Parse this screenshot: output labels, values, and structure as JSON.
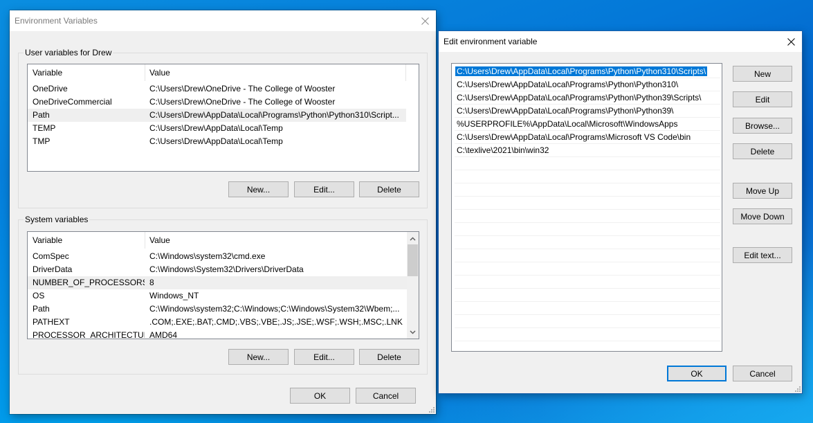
{
  "env_dialog": {
    "title": "Environment Variables",
    "user_group": {
      "label": "User variables for Drew",
      "columns": [
        "Variable",
        "Value"
      ],
      "rows": [
        {
          "variable": "OneDrive",
          "value": "C:\\Users\\Drew\\OneDrive - The College of Wooster"
        },
        {
          "variable": "OneDriveCommercial",
          "value": "C:\\Users\\Drew\\OneDrive - The College of Wooster"
        },
        {
          "variable": "Path",
          "value": "C:\\Users\\Drew\\AppData\\Local\\Programs\\Python\\Python310\\Script..."
        },
        {
          "variable": "TEMP",
          "value": "C:\\Users\\Drew\\AppData\\Local\\Temp"
        },
        {
          "variable": "TMP",
          "value": "C:\\Users\\Drew\\AppData\\Local\\Temp"
        }
      ],
      "highlighted_row": 2,
      "buttons": {
        "new": "New...",
        "edit": "Edit...",
        "delete": "Delete"
      }
    },
    "system_group": {
      "label": "System variables",
      "columns": [
        "Variable",
        "Value"
      ],
      "rows": [
        {
          "variable": "ComSpec",
          "value": "C:\\Windows\\system32\\cmd.exe"
        },
        {
          "variable": "DriverData",
          "value": "C:\\Windows\\System32\\Drivers\\DriverData"
        },
        {
          "variable": "NUMBER_OF_PROCESSORS",
          "value": "8"
        },
        {
          "variable": "OS",
          "value": "Windows_NT"
        },
        {
          "variable": "Path",
          "value": "C:\\Windows\\system32;C:\\Windows;C:\\Windows\\System32\\Wbem;..."
        },
        {
          "variable": "PATHEXT",
          "value": ".COM;.EXE;.BAT;.CMD;.VBS;.VBE;.JS;.JSE;.WSF;.WSH;.MSC;.LNK"
        },
        {
          "variable": "PROCESSOR_ARCHITECTURE",
          "value": "AMD64"
        }
      ],
      "highlighted_row": 2,
      "buttons": {
        "new": "New...",
        "edit": "Edit...",
        "delete": "Delete"
      }
    },
    "ok_label": "OK",
    "cancel_label": "Cancel"
  },
  "edit_dialog": {
    "title": "Edit environment variable",
    "entries": [
      "C:\\Users\\Drew\\AppData\\Local\\Programs\\Python\\Python310\\Scripts\\",
      "C:\\Users\\Drew\\AppData\\Local\\Programs\\Python\\Python310\\",
      "C:\\Users\\Drew\\AppData\\Local\\Programs\\Python\\Python39\\Scripts\\",
      "C:\\Users\\Drew\\AppData\\Local\\Programs\\Python\\Python39\\",
      "%USERPROFILE%\\AppData\\Local\\Microsoft\\WindowsApps",
      "C:\\Users\\Drew\\AppData\\Local\\Programs\\Microsoft VS Code\\bin",
      "C:\\texlive\\2021\\bin\\win32"
    ],
    "selected_index": 0,
    "buttons": {
      "new": "New",
      "edit": "Edit",
      "browse": "Browse...",
      "delete": "Delete",
      "move_up": "Move Up",
      "move_down": "Move Down",
      "edit_text": "Edit text..."
    },
    "ok_label": "OK",
    "cancel_label": "Cancel"
  },
  "colors": {
    "selection": "#0078d7",
    "dialog_bg": "#f0f0f0",
    "button_bg": "#e1e1e1",
    "hover_row": "#efefef"
  }
}
